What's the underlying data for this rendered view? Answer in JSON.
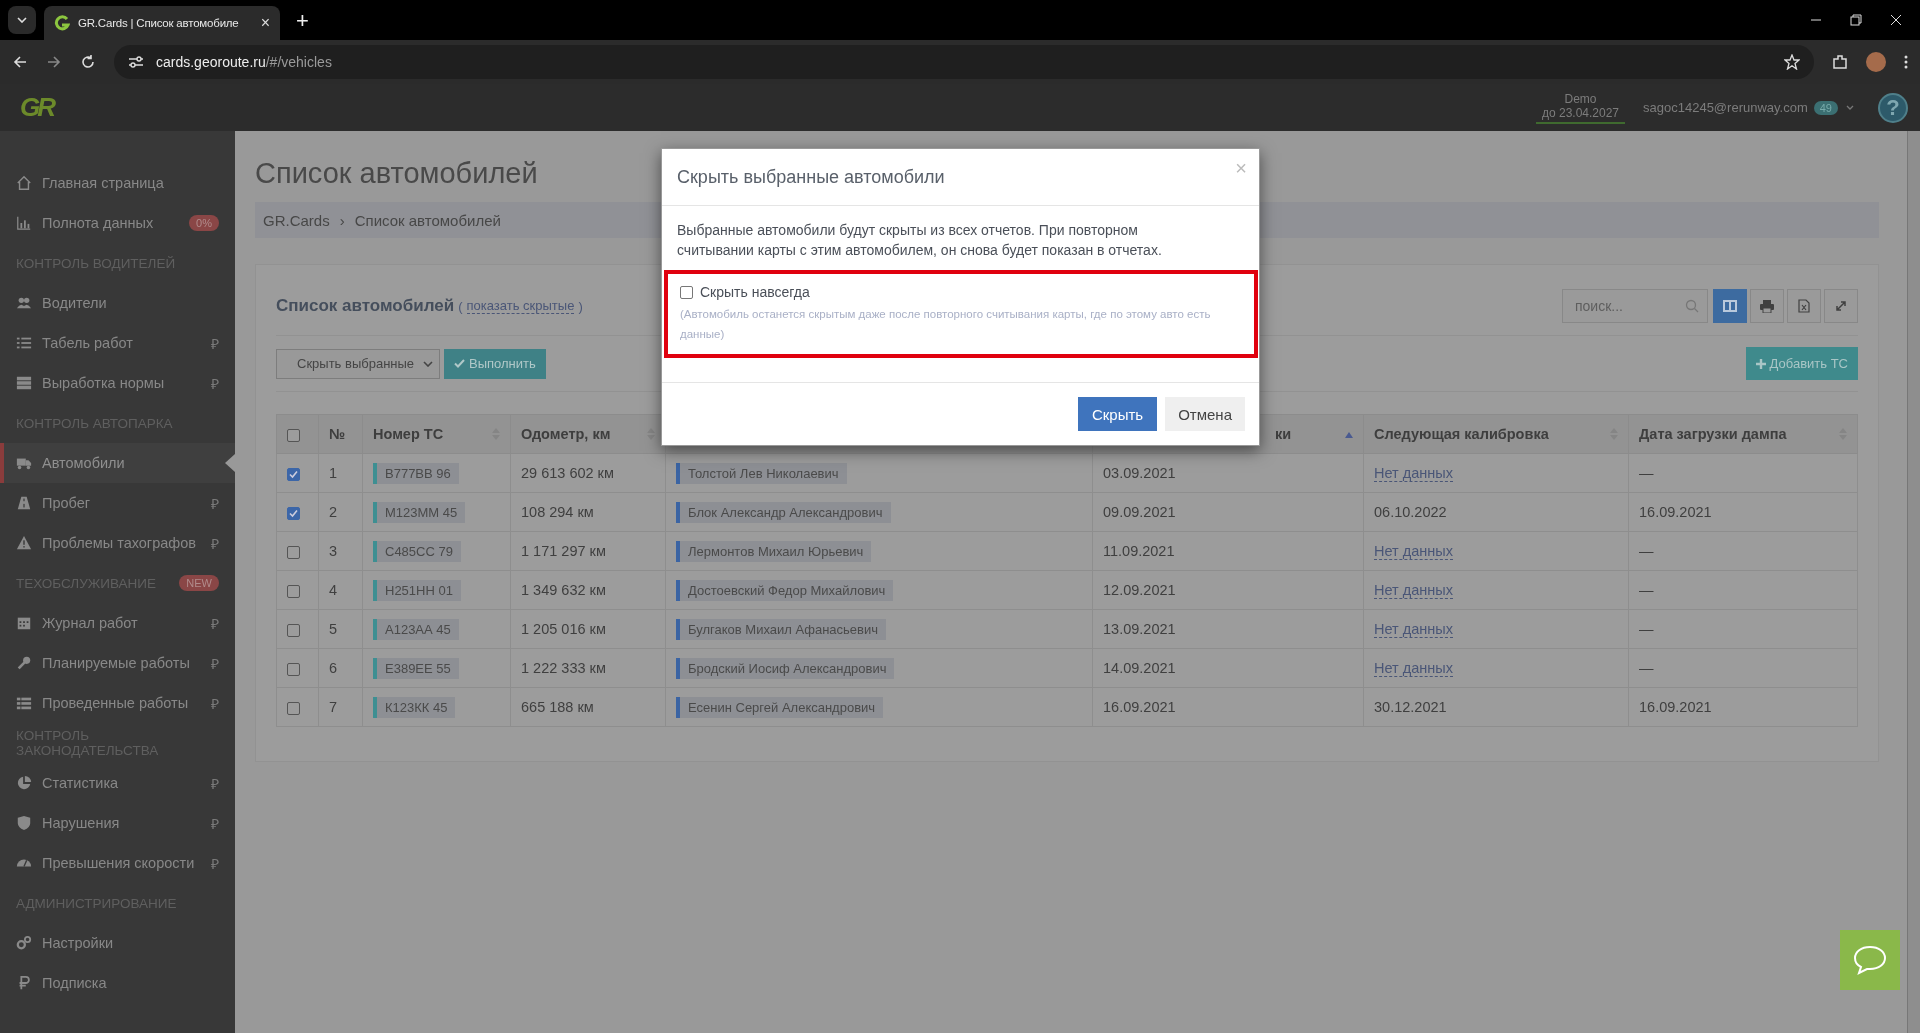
{
  "browser": {
    "tab_title": "GR.Cards | Список автомобиле",
    "tab_close": "×",
    "new_tab": "+",
    "url_host": "cards.georoute.ru",
    "url_path": "/#/vehicles"
  },
  "header": {
    "logo": "GR",
    "plan": "Demo",
    "until": "до 23.04.2027",
    "email": "sagoc14245@rerunway.com",
    "count": "49",
    "help": "?"
  },
  "sidebar": {
    "items": [
      {
        "kind": "link",
        "label": "Главная страница",
        "selected": false
      },
      {
        "kind": "link",
        "label": "Полнота данных",
        "selected": false,
        "badge": "0%"
      },
      {
        "kind": "section",
        "label": "КОНТРОЛЬ ВОДИТЕЛЕЙ"
      },
      {
        "kind": "link",
        "label": "Водители",
        "selected": false
      },
      {
        "kind": "link",
        "label": "Табель работ",
        "selected": false,
        "suffix": "₽"
      },
      {
        "kind": "link",
        "label": "Выработка нормы",
        "selected": false,
        "suffix": "₽"
      },
      {
        "kind": "section",
        "label": "КОНТРОЛЬ АВТОПАРКА"
      },
      {
        "kind": "link",
        "label": "Автомобили",
        "selected": true
      },
      {
        "kind": "link",
        "label": "Пробег",
        "selected": false,
        "suffix": "₽"
      },
      {
        "kind": "link",
        "label": "Проблемы тахографов",
        "selected": false,
        "suffix": "₽"
      },
      {
        "kind": "section",
        "label": "ТЕХОБСЛУЖИВАНИЕ",
        "badge": "NEW"
      },
      {
        "kind": "link",
        "label": "Журнал работ",
        "selected": false,
        "suffix": "₽"
      },
      {
        "kind": "link",
        "label": "Планируемые работы",
        "selected": false,
        "suffix": "₽"
      },
      {
        "kind": "link",
        "label": "Проведенные работы",
        "selected": false,
        "suffix": "₽"
      },
      {
        "kind": "section",
        "label": "КОНТРОЛЬ ЗАКОНОДАТЕЛЬСТВА"
      },
      {
        "kind": "link",
        "label": "Статистика",
        "selected": false,
        "suffix": "₽"
      },
      {
        "kind": "link",
        "label": "Нарушения",
        "selected": false,
        "suffix": "₽"
      },
      {
        "kind": "link",
        "label": "Превышения скорости",
        "selected": false,
        "suffix": "₽"
      },
      {
        "kind": "section",
        "label": "АДМИНИСТРИРОВАНИЕ"
      },
      {
        "kind": "link",
        "label": "Настройки",
        "selected": false
      },
      {
        "kind": "link",
        "label": "Подписка",
        "selected": false
      }
    ]
  },
  "page": {
    "title": "Список автомобилей",
    "breadcrumbs": [
      "GR.Cards",
      "Список автомобилей"
    ],
    "breadcrumb_separator": "›",
    "panel_title": "Список автомобилей",
    "show_hidden": {
      "before": "(",
      "label": "показать скрытые",
      "after": ")"
    },
    "action_select": "Скрыть выбранные",
    "execute_button": "Выполнить",
    "search": {
      "placeholder": "поиск..."
    },
    "toolbar": [
      {
        "kind": "columns",
        "selected": true
      },
      {
        "kind": "print",
        "selected": false
      },
      {
        "kind": "excel",
        "selected": false
      },
      {
        "kind": "expand",
        "selected": false
      }
    ],
    "add_button": "Добавить ТС"
  },
  "table": {
    "columns": [
      {
        "kind": "check",
        "checked": false
      },
      {
        "kind": "text",
        "label": "№"
      },
      {
        "kind": "text",
        "label": "Номер ТС",
        "sorted": false
      },
      {
        "kind": "text",
        "label": "Одометр, км",
        "sorted": false
      },
      {
        "kind": "hidden"
      },
      {
        "kind": "partial",
        "label": "ки",
        "sorted": true
      },
      {
        "kind": "text",
        "label": "Следующая калибровка",
        "sorted": false
      },
      {
        "kind": "text",
        "label": "Дата загрузки дампа",
        "sorted": false
      }
    ],
    "rows": [
      {
        "selected": true,
        "n": "1",
        "plate": "В777ВВ 96",
        "odometer": "29 613 602 км",
        "driver": "Толстой Лев Николаевич",
        "date": "03.09.2021",
        "calibration": {
          "text": "Нет данных",
          "link": true
        },
        "dump": "—"
      },
      {
        "selected": true,
        "n": "2",
        "plate": "М123ММ 45",
        "odometer": "108 294 км",
        "driver": "Блок Александр Александрович",
        "date": "09.09.2021",
        "calibration": {
          "text": "06.10.2022",
          "link": false
        },
        "dump": "16.09.2021"
      },
      {
        "selected": false,
        "n": "3",
        "plate": "С485СС 79",
        "odometer": "1 171 297 км",
        "driver": "Лермонтов Михаил Юрьевич",
        "date": "11.09.2021",
        "calibration": {
          "text": "Нет данных",
          "link": true
        },
        "dump": "—"
      },
      {
        "selected": false,
        "n": "4",
        "plate": "Н251НН 01",
        "odometer": "1 349 632 км",
        "driver": "Достоевский Федор Михайлович",
        "date": "12.09.2021",
        "calibration": {
          "text": "Нет данных",
          "link": true
        },
        "dump": "—"
      },
      {
        "selected": false,
        "n": "5",
        "plate": "А123АА 45",
        "odometer": "1 205 016 км",
        "driver": "Булгаков Михаил Афанасьевич",
        "date": "13.09.2021",
        "calibration": {
          "text": "Нет данных",
          "link": true
        },
        "dump": "—"
      },
      {
        "selected": false,
        "n": "6",
        "plate": "Е389ЕЕ 55",
        "odometer": "1 222 333 км",
        "driver": "Бродский Иосиф Александрович",
        "date": "14.09.2021",
        "calibration": {
          "text": "Нет данных",
          "link": true
        },
        "dump": "—"
      },
      {
        "selected": false,
        "n": "7",
        "plate": "К123КК 45",
        "odometer": "665 188 км",
        "driver": "Есенин Сергей Александрович",
        "date": "16.09.2021",
        "calibration": {
          "text": "30.12.2021",
          "link": false
        },
        "dump": "16.09.2021"
      }
    ]
  },
  "modal": {
    "title": "Скрыть выбранные автомобили",
    "close": "×",
    "text": "Выбранные автомобили будут скрыты из всех отчетов. При повторном считывании карты с этим автомобилем, он снова будет показан в отчетах.",
    "option": {
      "label": "Скрыть навсегда",
      "checked": false,
      "highlighted": true,
      "hint": "(Автомобиль останется скрытым даже после повторного считывания карты, где по этому авто есть данные)"
    },
    "confirm_button": "Скрыть",
    "cancel_button": "Отмена"
  }
}
